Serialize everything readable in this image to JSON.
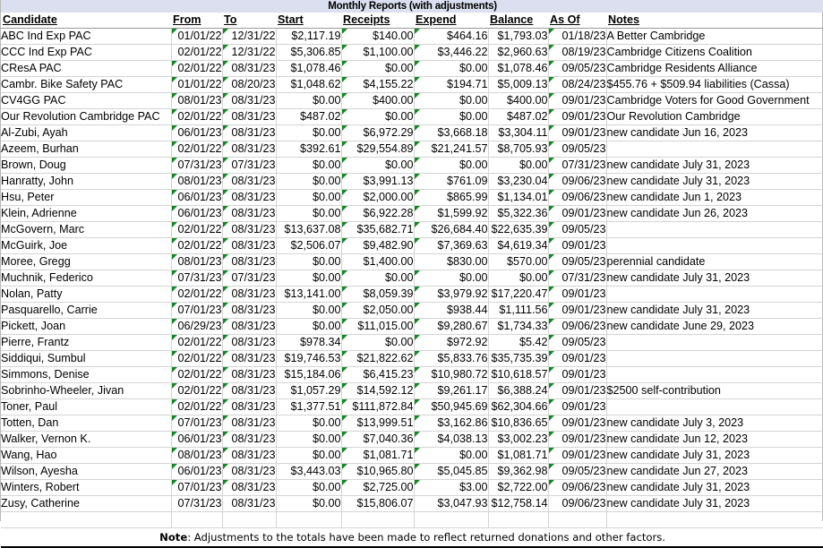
{
  "title": "Monthly Reports (with adjustments)",
  "columns": [
    "Candidate",
    "From",
    "To",
    "Start",
    "Receipts",
    "Expend",
    "Balance",
    "As Of",
    "Notes"
  ],
  "note_label": "Note",
  "note_text": ": Adjustments to the totals have been made to reflect returned donations and other factors.",
  "colors": {
    "title_background": "#dbdff0",
    "error_triangle": "#118822",
    "grid_line": "#d4d4d4",
    "text": "#000000"
  },
  "rows": [
    {
      "candidate": "ABC Ind Exp PAC",
      "from": "01/01/22",
      "to": "12/31/22",
      "start": "$2,117.19",
      "receipts": "$140.00",
      "expend": "$464.16",
      "balance": "$1,793.03",
      "asof": "01/18/23",
      "notes": "A Better Cambridge",
      "flags": {
        "from": true,
        "to": true,
        "start": false,
        "receipts": true,
        "expend": true,
        "balance": false,
        "asof": true
      }
    },
    {
      "candidate": "CCC Ind Exp PAC",
      "from": "02/01/22",
      "to": "12/31/22",
      "start": "$5,306.85",
      "receipts": "$1,100.00",
      "expend": "$3,446.22",
      "balance": "$2,960.63",
      "asof": "08/19/23",
      "notes": "Cambridge Citizens Coalition",
      "flags": {
        "from": false,
        "to": true,
        "start": false,
        "receipts": true,
        "expend": true,
        "balance": false,
        "asof": true
      }
    },
    {
      "candidate": "CResA PAC",
      "from": "02/01/22",
      "to": "08/31/23",
      "start": "$1,078.46",
      "receipts": "$0.00",
      "expend": "$0.00",
      "balance": "$1,078.46",
      "asof": "09/05/23",
      "notes": "Cambridge Residents Alliance",
      "flags": {
        "from": true,
        "to": true,
        "start": false,
        "receipts": true,
        "expend": true,
        "balance": false,
        "asof": true
      }
    },
    {
      "candidate": "Cambr. Bike Safety PAC",
      "from": "01/01/22",
      "to": "08/20/23",
      "start": "$1,048.62",
      "receipts": "$4,155.22",
      "expend": "$194.71",
      "balance": "$5,009.13",
      "asof": "08/24/23",
      "notes": "$455.76 + $509.94 liabilities (Cassa)",
      "flags": {
        "from": true,
        "to": true,
        "start": false,
        "receipts": true,
        "expend": true,
        "balance": false,
        "asof": true
      }
    },
    {
      "candidate": "CV4GG PAC",
      "from": "08/01/23",
      "to": "08/31/23",
      "start": "$0.00",
      "receipts": "$400.00",
      "expend": "$0.00",
      "balance": "$400.00",
      "asof": "09/01/23",
      "notes": "Cambridge Voters for Good Government",
      "flags": {
        "from": true,
        "to": true,
        "start": false,
        "receipts": true,
        "expend": true,
        "balance": false,
        "asof": true
      }
    },
    {
      "candidate": "Our Revolution Cambridge PAC",
      "from": "02/01/22",
      "to": "08/31/23",
      "start": "$487.02",
      "receipts": "$0.00",
      "expend": "$0.00",
      "balance": "$487.02",
      "asof": "09/01/23",
      "notes": "Our Revolution Cambridge",
      "flags": {
        "from": true,
        "to": true,
        "start": false,
        "receipts": true,
        "expend": true,
        "balance": false,
        "asof": true
      }
    },
    {
      "candidate": "Al-Zubi, Ayah",
      "from": "06/01/23",
      "to": "08/31/23",
      "start": "$0.00",
      "receipts": "$6,972.29",
      "expend": "$3,668.18",
      "balance": "$3,304.11",
      "asof": "09/01/23",
      "notes": "new candidate Jun 16, 2023",
      "flags": {
        "from": true,
        "to": true,
        "start": false,
        "receipts": true,
        "expend": true,
        "balance": false,
        "asof": true
      }
    },
    {
      "candidate": "Azeem, Burhan",
      "from": "02/01/22",
      "to": "08/31/23",
      "start": "$392.61",
      "receipts": "$29,554.89",
      "expend": "$21,241.57",
      "balance": "$8,705.93",
      "asof": "09/05/23",
      "notes": "",
      "flags": {
        "from": true,
        "to": true,
        "start": false,
        "receipts": true,
        "expend": true,
        "balance": false,
        "asof": true
      }
    },
    {
      "candidate": "Brown, Doug",
      "from": "07/31/23",
      "to": "07/31/23",
      "start": "$0.00",
      "receipts": "$0.00",
      "expend": "$0.00",
      "balance": "$0.00",
      "asof": "07/31/23",
      "notes": "new candidate July 31, 2023",
      "flags": {
        "from": true,
        "to": true,
        "start": false,
        "receipts": true,
        "expend": true,
        "balance": false,
        "asof": true
      }
    },
    {
      "candidate": "Hanratty, John",
      "from": "08/01/23",
      "to": "08/31/23",
      "start": "$0.00",
      "receipts": "$3,991.13",
      "expend": "$761.09",
      "balance": "$3,230.04",
      "asof": "09/06/23",
      "notes": "new candidate July 31, 2023",
      "flags": {
        "from": true,
        "to": true,
        "start": false,
        "receipts": true,
        "expend": true,
        "balance": false,
        "asof": true
      }
    },
    {
      "candidate": "Hsu, Peter",
      "from": "06/01/23",
      "to": "08/31/23",
      "start": "$0.00",
      "receipts": "$2,000.00",
      "expend": "$865.99",
      "balance": "$1,134.01",
      "asof": "09/06/23",
      "notes": "new candidate Jun 1, 2023",
      "flags": {
        "from": true,
        "to": true,
        "start": false,
        "receipts": true,
        "expend": true,
        "balance": false,
        "asof": true
      }
    },
    {
      "candidate": "Klein, Adrienne",
      "from": "06/01/23",
      "to": "08/31/23",
      "start": "$0.00",
      "receipts": "$6,922.28",
      "expend": "$1,599.92",
      "balance": "$5,322.36",
      "asof": "09/01/23",
      "notes": "new candidate Jun 26, 2023",
      "flags": {
        "from": true,
        "to": true,
        "start": false,
        "receipts": true,
        "expend": true,
        "balance": false,
        "asof": true
      }
    },
    {
      "candidate": "McGovern, Marc",
      "from": "02/01/22",
      "to": "08/31/23",
      "start": "$13,637.08",
      "receipts": "$35,682.71",
      "expend": "$26,684.40",
      "balance": "$22,635.39",
      "asof": "09/05/23",
      "notes": "",
      "flags": {
        "from": true,
        "to": true,
        "start": false,
        "receipts": true,
        "expend": true,
        "balance": false,
        "asof": true
      }
    },
    {
      "candidate": "McGuirk, Joe",
      "from": "02/01/22",
      "to": "08/31/23",
      "start": "$2,506.07",
      "receipts": "$9,482.90",
      "expend": "$7,369.63",
      "balance": "$4,619.34",
      "asof": "09/01/23",
      "notes": "",
      "flags": {
        "from": true,
        "to": true,
        "start": false,
        "receipts": true,
        "expend": true,
        "balance": false,
        "asof": true
      }
    },
    {
      "candidate": "Moree, Gregg",
      "from": "08/01/23",
      "to": "08/31/23",
      "start": "$0.00",
      "receipts": "$1,400.00",
      "expend": "$830.00",
      "balance": "$570.00",
      "asof": "09/05/23",
      "notes": "perennial candidate",
      "flags": {
        "from": true,
        "to": true,
        "start": false,
        "receipts": false,
        "expend": false,
        "balance": false,
        "asof": true
      }
    },
    {
      "candidate": "Muchnik, Federico",
      "from": "07/31/23",
      "to": "07/31/23",
      "start": "$0.00",
      "receipts": "$0.00",
      "expend": "$0.00",
      "balance": "$0.00",
      "asof": "07/31/23",
      "notes": "new candidate July 31, 2023",
      "flags": {
        "from": true,
        "to": true,
        "start": false,
        "receipts": true,
        "expend": true,
        "balance": false,
        "asof": true
      }
    },
    {
      "candidate": "Nolan, Patty",
      "from": "02/01/22",
      "to": "08/31/23",
      "start": "$13,141.00",
      "receipts": "$8,059.39",
      "expend": "$3,979.92",
      "balance": "$17,220.47",
      "asof": "09/01/23",
      "notes": "",
      "flags": {
        "from": true,
        "to": true,
        "start": false,
        "receipts": true,
        "expend": true,
        "balance": false,
        "asof": true
      }
    },
    {
      "candidate": "Pasquarello, Carrie",
      "from": "07/01/23",
      "to": "08/31/23",
      "start": "$0.00",
      "receipts": "$2,050.00",
      "expend": "$938.44",
      "balance": "$1,111.56",
      "asof": "09/01/23",
      "notes": "new candidate July 31, 2023",
      "flags": {
        "from": true,
        "to": true,
        "start": false,
        "receipts": true,
        "expend": true,
        "balance": false,
        "asof": true
      }
    },
    {
      "candidate": "Pickett, Joan",
      "from": "06/29/23",
      "to": "08/31/23",
      "start": "$0.00",
      "receipts": "$11,015.00",
      "expend": "$9,280.67",
      "balance": "$1,734.33",
      "asof": "09/06/23",
      "notes": "new candidate June 29, 2023",
      "flags": {
        "from": true,
        "to": true,
        "start": false,
        "receipts": true,
        "expend": true,
        "balance": false,
        "asof": true
      }
    },
    {
      "candidate": "Pierre, Frantz",
      "from": "02/01/22",
      "to": "08/31/23",
      "start": "$978.34",
      "receipts": "$0.00",
      "expend": "$972.92",
      "balance": "$5.42",
      "asof": "09/05/23",
      "notes": "",
      "flags": {
        "from": true,
        "to": true,
        "start": false,
        "receipts": true,
        "expend": true,
        "balance": false,
        "asof": true
      }
    },
    {
      "candidate": "Siddiqui, Sumbul",
      "from": "02/01/22",
      "to": "08/31/23",
      "start": "$19,746.53",
      "receipts": "$21,822.62",
      "expend": "$5,833.76",
      "balance": "$35,735.39",
      "asof": "09/01/23",
      "notes": "",
      "flags": {
        "from": true,
        "to": true,
        "start": false,
        "receipts": true,
        "expend": true,
        "balance": false,
        "asof": true
      }
    },
    {
      "candidate": "Simmons, Denise",
      "from": "02/01/22",
      "to": "08/31/23",
      "start": "$15,184.06",
      "receipts": "$6,415.23",
      "expend": "$10,980.72",
      "balance": "$10,618.57",
      "asof": "09/01/23",
      "notes": "",
      "flags": {
        "from": true,
        "to": true,
        "start": false,
        "receipts": true,
        "expend": true,
        "balance": false,
        "asof": true
      }
    },
    {
      "candidate": "Sobrinho-Wheeler, Jivan",
      "from": "02/01/22",
      "to": "08/31/23",
      "start": "$1,057.29",
      "receipts": "$14,592.12",
      "expend": "$9,261.17",
      "balance": "$6,388.24",
      "asof": "09/01/23",
      "notes": "$2500 self-contribution",
      "flags": {
        "from": true,
        "to": true,
        "start": false,
        "receipts": true,
        "expend": true,
        "balance": false,
        "asof": true
      }
    },
    {
      "candidate": "Toner, Paul",
      "from": "02/01/22",
      "to": "08/31/23",
      "start": "$1,377.51",
      "receipts": "$111,872.84",
      "expend": "$50,945.69",
      "balance": "$62,304.66",
      "asof": "09/01/23",
      "notes": "",
      "flags": {
        "from": true,
        "to": true,
        "start": false,
        "receipts": true,
        "expend": true,
        "balance": false,
        "asof": true
      }
    },
    {
      "candidate": "Totten, Dan",
      "from": "07/01/23",
      "to": "08/31/23",
      "start": "$0.00",
      "receipts": "$13,999.51",
      "expend": "$3,162.86",
      "balance": "$10,836.65",
      "asof": "09/01/23",
      "notes": "new candidate July 3, 2023",
      "flags": {
        "from": true,
        "to": true,
        "start": false,
        "receipts": true,
        "expend": true,
        "balance": false,
        "asof": true
      }
    },
    {
      "candidate": "Walker, Vernon K.",
      "from": "06/01/23",
      "to": "08/31/23",
      "start": "$0.00",
      "receipts": "$7,040.36",
      "expend": "$4,038.13",
      "balance": "$3,002.23",
      "asof": "09/01/23",
      "notes": "new candidate Jun 12, 2023",
      "flags": {
        "from": true,
        "to": true,
        "start": false,
        "receipts": true,
        "expend": true,
        "balance": false,
        "asof": true
      }
    },
    {
      "candidate": "Wang, Hao",
      "from": "08/01/23",
      "to": "08/31/23",
      "start": "$0.00",
      "receipts": "$1,081.71",
      "expend": "$0.00",
      "balance": "$1,081.71",
      "asof": "09/01/23",
      "notes": "new candidate July 31, 2023",
      "flags": {
        "from": true,
        "to": true,
        "start": false,
        "receipts": true,
        "expend": true,
        "balance": false,
        "asof": true
      }
    },
    {
      "candidate": "Wilson, Ayesha",
      "from": "06/01/23",
      "to": "08/31/23",
      "start": "$3,443.03",
      "receipts": "$10,965.80",
      "expend": "$5,045.85",
      "balance": "$9,362.98",
      "asof": "09/05/23",
      "notes": "new candidate Jun 27, 2023",
      "flags": {
        "from": true,
        "to": true,
        "start": false,
        "receipts": true,
        "expend": true,
        "balance": false,
        "asof": true
      }
    },
    {
      "candidate": "Winters, Robert",
      "from": "07/01/23",
      "to": "08/31/23",
      "start": "$0.00",
      "receipts": "$2,725.00",
      "expend": "$3.00",
      "balance": "$2,722.00",
      "asof": "09/06/23",
      "notes": "new candidate July 31, 2023",
      "flags": {
        "from": true,
        "to": true,
        "start": false,
        "receipts": true,
        "expend": true,
        "balance": false,
        "asof": true
      }
    },
    {
      "candidate": "Zusy, Catherine",
      "from": "07/31/23",
      "to": "08/31/23",
      "start": "$0.00",
      "receipts": "$15,806.07",
      "expend": "$3,047.93",
      "balance": "$12,758.14",
      "asof": "09/06/23",
      "notes": "new candidate July 31, 2023",
      "flags": {
        "from": false,
        "to": false,
        "start": false,
        "receipts": false,
        "expend": false,
        "balance": false,
        "asof": false
      }
    }
  ]
}
